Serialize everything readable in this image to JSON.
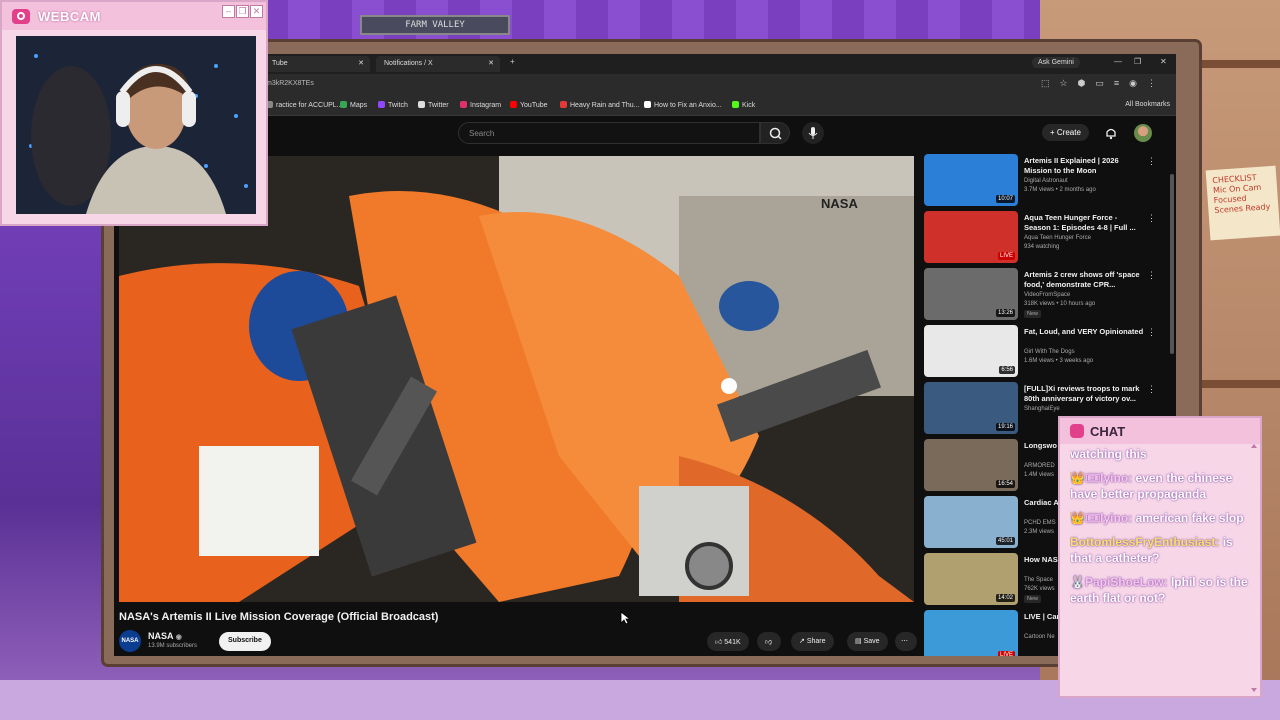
{
  "room": {
    "sign_text": "FARM VALLEY",
    "checklist_text": "CHECKLIST Mic On Cam Focused Scenes Ready"
  },
  "webcam": {
    "title": "WEBCAM"
  },
  "browser": {
    "tabs": [
      {
        "label": "Tube"
      },
      {
        "label": "Notifications / X"
      }
    ],
    "ask_gemini": "Ask Gemini",
    "url": "m3kR2KX8TEs",
    "bookmarks": [
      {
        "label": "ractice for ACCUPL...",
        "color": "#888888"
      },
      {
        "label": "Maps",
        "color": "#34a853"
      },
      {
        "label": "Twitch",
        "color": "#9146ff"
      },
      {
        "label": "Twitter",
        "color": "#dddddd"
      },
      {
        "label": "Instagram",
        "color": "#e1306c"
      },
      {
        "label": "YouTube",
        "color": "#ff0000"
      },
      {
        "label": "Heavy Rain and Thu...",
        "color": "#e53935"
      },
      {
        "label": "How to Fix an Anxio...",
        "color": "#ffffff"
      },
      {
        "label": "Kick",
        "color": "#53fc18"
      }
    ],
    "all_bookmarks": "All Bookmarks"
  },
  "youtube": {
    "search_placeholder": "Search",
    "create_label": "Create",
    "video": {
      "title": "NASA's Artemis II Live Mission Coverage (Official Broadcast)",
      "channel": "NASA",
      "subscribers": "13.9M subscribers",
      "subscribe_label": "Subscribe",
      "likes": "541K",
      "share_label": "Share",
      "save_label": "Save",
      "logo_text": "NASA",
      "watermark": "NASA"
    },
    "recommendations": [
      {
        "title": "Artemis II Explained | 2026 Mission to the Moon",
        "channel": "Digital Astronaut",
        "meta": "3.7M views • 2 months ago",
        "duration": "10:07",
        "live": false,
        "new": false
      },
      {
        "title": "Aqua Teen Hunger Force - Season 1: Episodes 4-8 | Full ...",
        "channel": "Aqua Teen Hunger Force",
        "meta": "934 watching",
        "duration": "LIVE",
        "live": true,
        "new": false
      },
      {
        "title": "Artemis 2 crew shows off 'space food,' demonstrate CPR...",
        "channel": "VideoFromSpace",
        "meta": "318K views • 10 hours ago",
        "duration": "13:26",
        "live": false,
        "new": true
      },
      {
        "title": "Fat, Loud, and VERY Opinionated",
        "channel": "Girl With The Dogs",
        "meta": "1.6M views • 3 weeks ago",
        "duration": "6:56",
        "live": false,
        "new": false
      },
      {
        "title": "[FULL]Xi reviews troops to mark 80th anniversary of victory ov...",
        "channel": "ShanghaiEye",
        "meta": "",
        "duration": "19:16",
        "live": false,
        "new": false
      },
      {
        "title": "Longswo MMA",
        "channel": "ARMORED",
        "meta": "1.4M views",
        "duration": "16:54",
        "live": false,
        "new": false
      },
      {
        "title": "Cardiac A Cam Vide",
        "channel": "PCHD EMS",
        "meta": "2.3M views",
        "duration": "45:01",
        "live": false,
        "new": false
      },
      {
        "title": "How NAS Artemis M",
        "channel": "The Space",
        "meta": "762K views",
        "duration": "14:02",
        "live": false,
        "new": true
      },
      {
        "title": "LIVE | Cartoon N",
        "channel": "Cartoon Ne",
        "meta": "",
        "duration": "LIVE",
        "live": true,
        "new": false
      }
    ]
  },
  "chat": {
    "title": "CHAT",
    "messages": [
      {
        "user": "",
        "text": "watching this",
        "gold": false
      },
      {
        "user": "👑🎟lyino:",
        "text": "even the chinese have better propaganda",
        "gold": false
      },
      {
        "user": "👑🎟lyino:",
        "text": "american fake slop",
        "gold": false
      },
      {
        "user": "BottomlessFryEnthusiast:",
        "text": "is that a catheter?",
        "gold": true
      },
      {
        "user": "🐰PapiShoeLow:",
        "text": "lphil so is the earth flat or not?",
        "gold": false
      }
    ]
  },
  "icons": [
    "webcam-icon",
    "chat-icon",
    "search-icon",
    "mic-icon",
    "bell-icon",
    "like-icon",
    "dislike-icon",
    "share-icon",
    "save-icon",
    "more-icon"
  ]
}
